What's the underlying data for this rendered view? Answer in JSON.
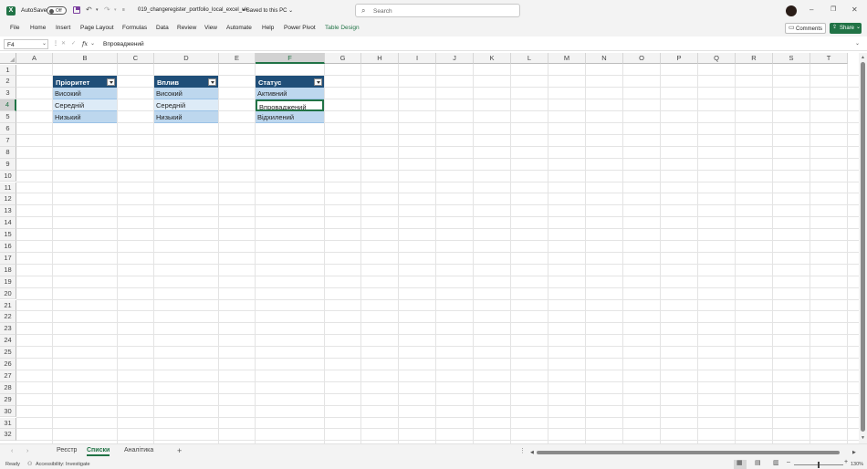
{
  "titlebar": {
    "autosave_label": "AutoSave",
    "autosave_state": "Off",
    "filename": "019_changeregister_portfolio_local_excel_uk",
    "save_status": "Saved to this PC",
    "search_placeholder": "Search"
  },
  "ribbon": {
    "tabs": [
      "File",
      "Home",
      "Insert",
      "Page Layout",
      "Formulas",
      "Data",
      "Review",
      "View",
      "Automate",
      "Help",
      "Power Pivot",
      "Table Design"
    ],
    "comments_label": "Comments",
    "share_label": "Share"
  },
  "formula_bar": {
    "name_box": "F4",
    "fx_label": "fx",
    "content": "Впроваджений"
  },
  "sheet": {
    "columns": [
      "A",
      "B",
      "C",
      "D",
      "E",
      "F",
      "G",
      "H",
      "I",
      "J",
      "K",
      "L",
      "M",
      "N",
      "O",
      "P",
      "Q",
      "R",
      "S",
      "T"
    ],
    "rows": [
      "1",
      "2",
      "3",
      "4",
      "5",
      "6",
      "7",
      "8",
      "9",
      "10",
      "11",
      "12",
      "13",
      "14",
      "15",
      "16",
      "17",
      "18",
      "19",
      "20",
      "21",
      "22",
      "23",
      "24",
      "25",
      "26",
      "27",
      "28",
      "29",
      "30",
      "31",
      "32"
    ],
    "selected_column": "F",
    "selected_row": "4",
    "tables": [
      {
        "header": "Пріоритет",
        "values": [
          "Високий",
          "Середній",
          "Низький"
        ]
      },
      {
        "header": "Вплив",
        "values": [
          "Високий",
          "Середній",
          "Низький"
        ]
      },
      {
        "header": "Статус",
        "values": [
          "Активний",
          "Впроваджений",
          "Відхилений"
        ]
      }
    ],
    "table_colors": {
      "header": "#1f4e78",
      "band1": "#ddebf7",
      "band2": "#bdd7ee"
    }
  },
  "sheet_tabs": [
    "Реєстр",
    "Списки",
    "Аналітика"
  ],
  "active_sheet": "Списки",
  "status_bar": {
    "ready": "Ready",
    "accessibility": "Accessibility: Investigate",
    "zoom": "130%"
  },
  "accent_color": "#217346"
}
